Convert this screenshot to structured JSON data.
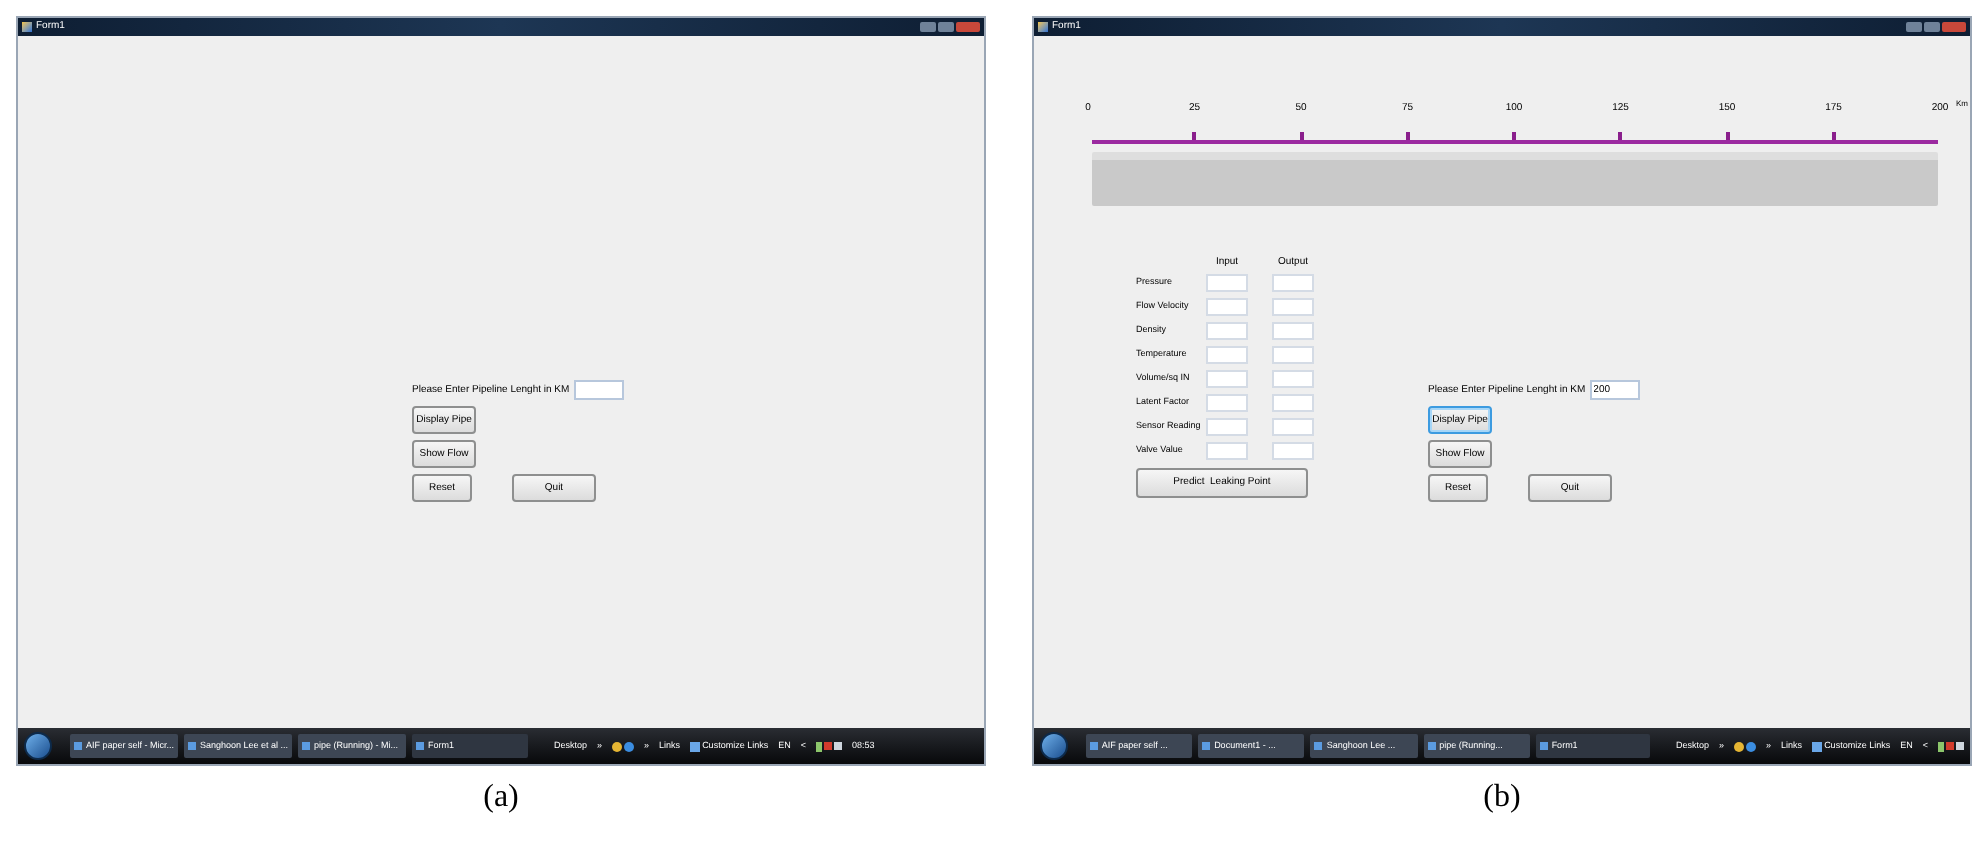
{
  "figures": [
    {
      "caption": "(a)",
      "window": {
        "title": "Form1"
      },
      "length_prompt": {
        "label": "Please Enter Pipeline Lenght in KM"
      },
      "buttons": [
        {
          "label": "Display Pipe",
          "focused": false
        },
        {
          "label": "Show Flow",
          "focused": false
        },
        {
          "label": "Reset",
          "focused": false
        },
        {
          "label": "Quit",
          "focused": false
        }
      ],
      "taskbar": {
        "tasks": [
          {
            "label": "AIF paper self - Micr...",
            "active": false
          },
          {
            "label": "Sanghoon Lee et al ...",
            "active": false
          },
          {
            "label": "pipe (Running) - Mi...",
            "active": false
          },
          {
            "label": "Form1",
            "active": true
          }
        ],
        "tray": [
          {
            "kind": "label",
            "label": "Desktop"
          },
          {
            "kind": "label",
            "label": "»"
          },
          {
            "kind": "browsers"
          },
          {
            "kind": "label",
            "label": "»"
          },
          {
            "kind": "label",
            "label": "Links"
          },
          {
            "kind": "link",
            "label": "Customize Links"
          },
          {
            "kind": "label",
            "label": "EN"
          },
          {
            "kind": "label",
            "label": "<"
          },
          {
            "kind": "icons"
          },
          {
            "kind": "label",
            "label": "08:53"
          }
        ]
      }
    },
    {
      "caption": "(b)",
      "window": {
        "title": "Form1"
      },
      "scale": {
        "labels": [
          "0",
          "25",
          "50",
          "75",
          "100",
          "125",
          "150",
          "175",
          "200"
        ],
        "unit": "Km"
      },
      "parameters": {
        "columns": [
          "Input",
          "Output"
        ],
        "rows": [
          "Pressure",
          "Flow Velocity",
          "Density",
          "Temperature",
          "Volume/sq IN",
          "Latent Factor",
          "Sensor Reading",
          "Valve Value"
        ],
        "button": "Predict  Leaking Point"
      },
      "length_prompt": {
        "label": "Please Enter Pipeline Lenght in KM",
        "value": "200"
      },
      "buttons": [
        {
          "label": "Display Pipe",
          "focused": true
        },
        {
          "label": "Show Flow",
          "focused": false
        },
        {
          "label": "Reset",
          "focused": false
        },
        {
          "label": "Quit",
          "focused": false
        }
      ],
      "taskbar": {
        "tasks": [
          {
            "label": "AIF paper self ...",
            "active": false
          },
          {
            "label": "Document1 - ...",
            "active": false
          },
          {
            "label": "Sanghoon Lee ...",
            "active": false
          },
          {
            "label": "pipe (Running...",
            "active": false
          },
          {
            "label": "Form1",
            "active": true
          }
        ],
        "tray": [
          {
            "kind": "label",
            "label": "Desktop"
          },
          {
            "kind": "label",
            "label": "»"
          },
          {
            "kind": "browsers"
          },
          {
            "kind": "label",
            "label": "»"
          },
          {
            "kind": "label",
            "label": "Links"
          },
          {
            "kind": "link",
            "label": "Customize Links"
          },
          {
            "kind": "label",
            "label": "EN"
          },
          {
            "kind": "label",
            "label": "<"
          },
          {
            "kind": "icons"
          }
        ]
      }
    }
  ]
}
